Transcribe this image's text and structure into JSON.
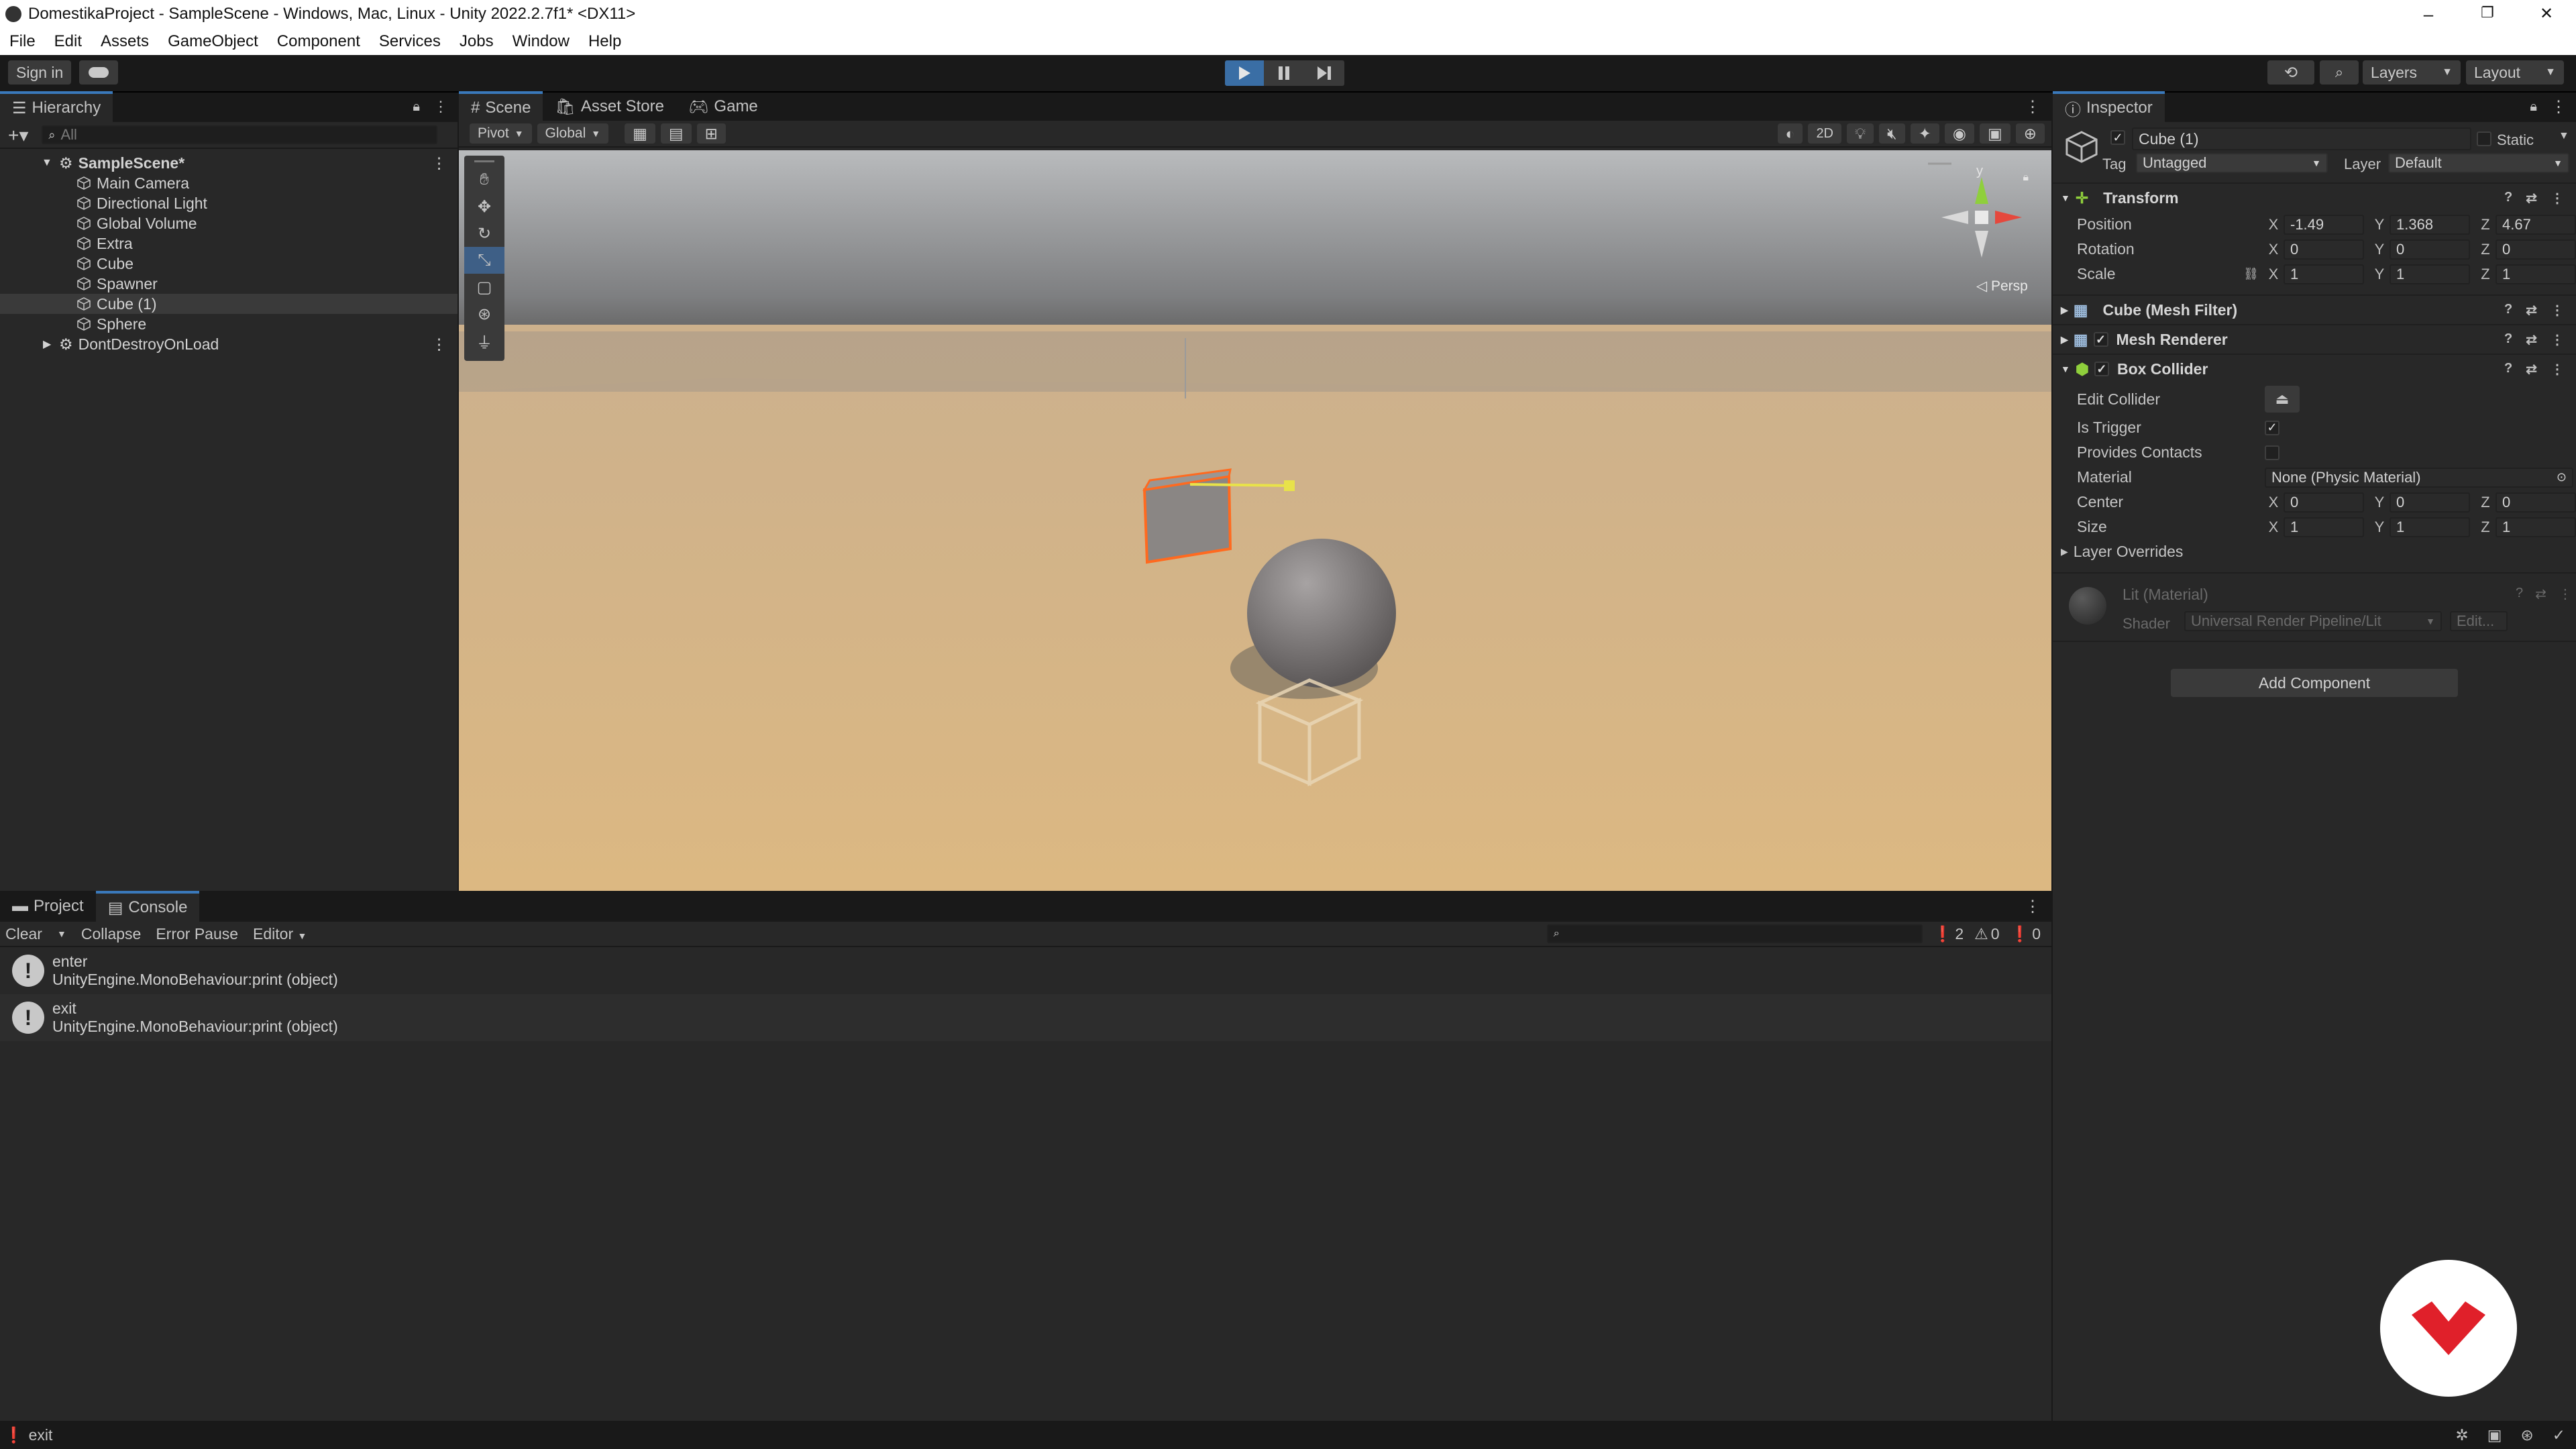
{
  "window": {
    "title": "DomestikaProject - SampleScene - Windows, Mac, Linux - Unity 2022.2.7f1* <DX11>",
    "minimize": "–",
    "maximize": "❐",
    "close": "✕"
  },
  "menu": [
    "File",
    "Edit",
    "Assets",
    "GameObject",
    "Component",
    "Services",
    "Jobs",
    "Window",
    "Help"
  ],
  "toolbar": {
    "sign_in": "Sign in",
    "layers": "Layers",
    "layout": "Layout"
  },
  "hierarchy": {
    "title": "Hierarchy",
    "search_placeholder": "All",
    "scene": "SampleScene*",
    "items": [
      "Main Camera",
      "Directional Light",
      "Global Volume",
      "Extra",
      "Cube",
      "Spawner",
      "Cube (1)",
      "Sphere"
    ],
    "dont_destroy": "DontDestroyOnLoad"
  },
  "scene_tabs": [
    "Scene",
    "Asset Store",
    "Game"
  ],
  "scene_toolbar": {
    "pivot": "Pivot",
    "global": "Global",
    "two_d": "2D",
    "persp": "◁ Persp",
    "gizmo_y": "y"
  },
  "inspector": {
    "title": "Inspector",
    "object_name": "Cube (1)",
    "static": "Static",
    "tag_label": "Tag",
    "tag_value": "Untagged",
    "layer_label": "Layer",
    "layer_value": "Default",
    "transform": {
      "title": "Transform",
      "position_label": "Position",
      "rotation_label": "Rotation",
      "scale_label": "Scale",
      "position": {
        "x": "-1.49",
        "y": "1.368",
        "z": "4.67"
      },
      "rotation": {
        "x": "0",
        "y": "0",
        "z": "0"
      },
      "scale": {
        "x": "1",
        "y": "1",
        "z": "1"
      }
    },
    "mesh_filter": "Cube (Mesh Filter)",
    "mesh_renderer": "Mesh Renderer",
    "box_collider": {
      "title": "Box Collider",
      "edit_collider": "Edit Collider",
      "is_trigger": "Is Trigger",
      "provides_contacts": "Provides Contacts",
      "material_label": "Material",
      "material_value": "None (Physic Material)",
      "center_label": "Center",
      "size_label": "Size",
      "center": {
        "x": "0",
        "y": "0",
        "z": "0"
      },
      "size": {
        "x": "1",
        "y": "1",
        "z": "1"
      },
      "layer_overrides": "Layer Overrides"
    },
    "material": {
      "name": "Lit (Material)",
      "shader_label": "Shader",
      "shader_value": "Universal Render Pipeline/Lit",
      "edit": "Edit..."
    },
    "add_component": "Add Component",
    "axis_x": "X",
    "axis_y": "Y",
    "axis_z": "Z"
  },
  "bottom_tabs": [
    "Project",
    "Console"
  ],
  "console": {
    "clear": "Clear",
    "collapse": "Collapse",
    "error_pause": "Error Pause",
    "editor": "Editor",
    "count_log": "2",
    "count_warn": "0",
    "count_err": "0",
    "entries": [
      {
        "line1": "enter",
        "line2": "UnityEngine.MonoBehaviour:print (object)"
      },
      {
        "line1": "exit",
        "line2": "UnityEngine.MonoBehaviour:print (object)"
      }
    ]
  },
  "status": {
    "text": "exit"
  },
  "colors": {
    "selection_outline": "#ff6a1f",
    "accent_blue": "#3a79bb",
    "domestika_red": "#e0202a"
  }
}
